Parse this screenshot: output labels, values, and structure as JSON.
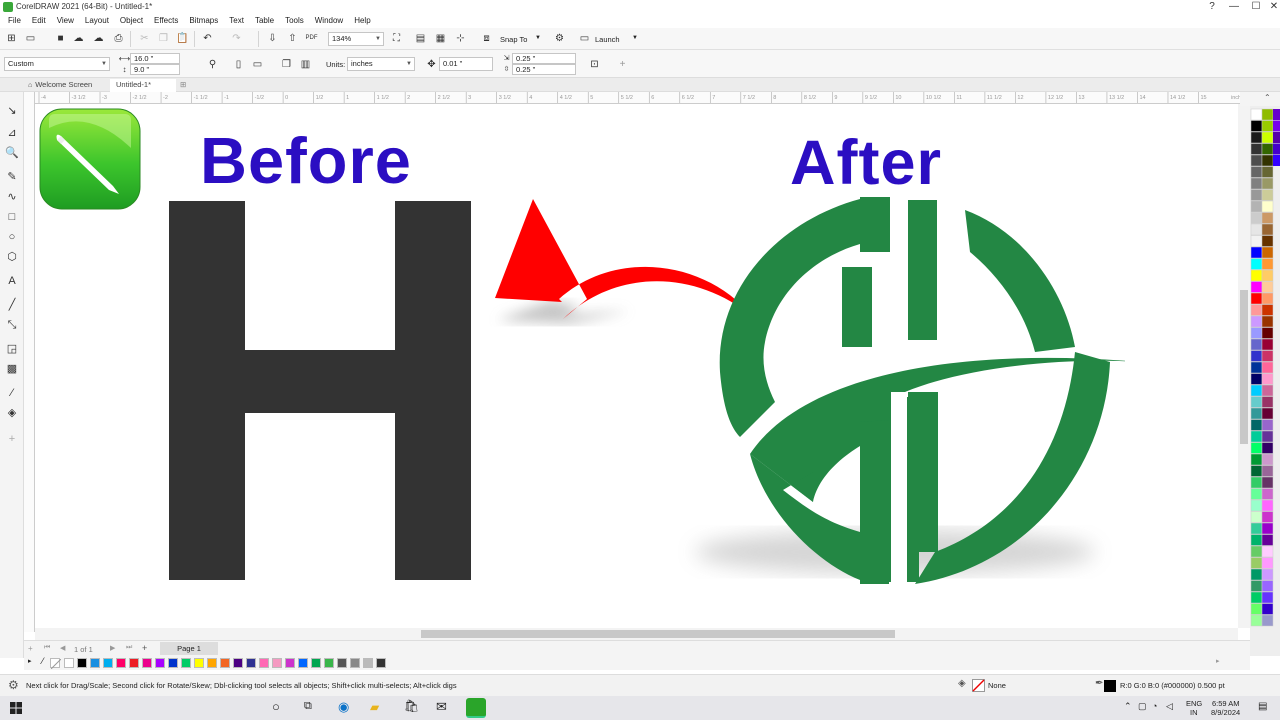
{
  "window": {
    "title": "CorelDRAW 2021 (64-Bit) - Untitled-1*",
    "controls": [
      "?",
      "—",
      "☐",
      "✕"
    ]
  },
  "menu": [
    "File",
    "Edit",
    "View",
    "Layout",
    "Object",
    "Effects",
    "Bitmaps",
    "Text",
    "Table",
    "Tools",
    "Window",
    "Help"
  ],
  "toolbar": {
    "zoom": "134%",
    "snap_to": "Snap To",
    "launch": "Launch"
  },
  "propbar": {
    "preset": "Custom",
    "width": "16.0 \"",
    "height": "9.0 \"",
    "units_label": "Units:",
    "units_value": "inches",
    "nudge": "0.01 \"",
    "dup_x": "0.25 \"",
    "dup_y": "0.25 \""
  },
  "tabs": [
    {
      "label": "Welcome Screen"
    },
    {
      "label": "Untitled-1*"
    }
  ],
  "ruler": {
    "units": "inches",
    "ticks": [
      "-4",
      "-3 1/2",
      "-3",
      "-2 1/2",
      "-2",
      "-1 1/2",
      "-1",
      "-1/2",
      "0",
      "1/2",
      "1",
      "1 1/2",
      "2",
      "2 1/2",
      "3",
      "3 1/2",
      "4",
      "4 1/2",
      "5",
      "5 1/2",
      "6",
      "6 1/2",
      "7",
      "7 1/2",
      "8",
      "8 1/2",
      "9",
      "9 1/2",
      "10",
      "10 1/2",
      "11",
      "11 1/2",
      "12",
      "12 1/2",
      "13",
      "13 1/2",
      "14",
      "14 1/2",
      "15"
    ]
  },
  "canvas": {
    "before_text": "Before",
    "after_text": "After",
    "letter": "H",
    "colors": {
      "title": "#2b0ec2",
      "letter": "#333333",
      "logo": "#238744",
      "arrow": "#ff0000"
    }
  },
  "pages": {
    "counter": "1 of 1",
    "page_tab": "Page 1"
  },
  "palette_bottom": [
    "#ffffff",
    "#000000",
    "#1a8fe0",
    "#00aeef",
    "#ff0066",
    "#ed1c24",
    "#ec008c",
    "#a800ff",
    "#0033cc",
    "#00cc66",
    "#ffff00",
    "#ffa500",
    "#f26522",
    "#4b0082",
    "#2e3192",
    "#ff69b4",
    "#f49ac1",
    "#cc33cc",
    "#0066ff",
    "#00a651",
    "#39b54a",
    "#555555",
    "#888888",
    "#bbbbbb",
    "#333333"
  ],
  "status": {
    "hint": "Next click for Drag/Scale; Second click for Rotate/Skew; Dbl-clicking tool selects all objects; Shift+click multi-selects; Alt+click digs",
    "fill_label": "None",
    "outline_info": "R:0 G:0 B:0 (#000000)  0.500 pt"
  },
  "taskbar": {
    "lang_top": "ENG",
    "lang_bottom": "IN",
    "time": "6:59 AM",
    "date": "8/9/2024"
  }
}
